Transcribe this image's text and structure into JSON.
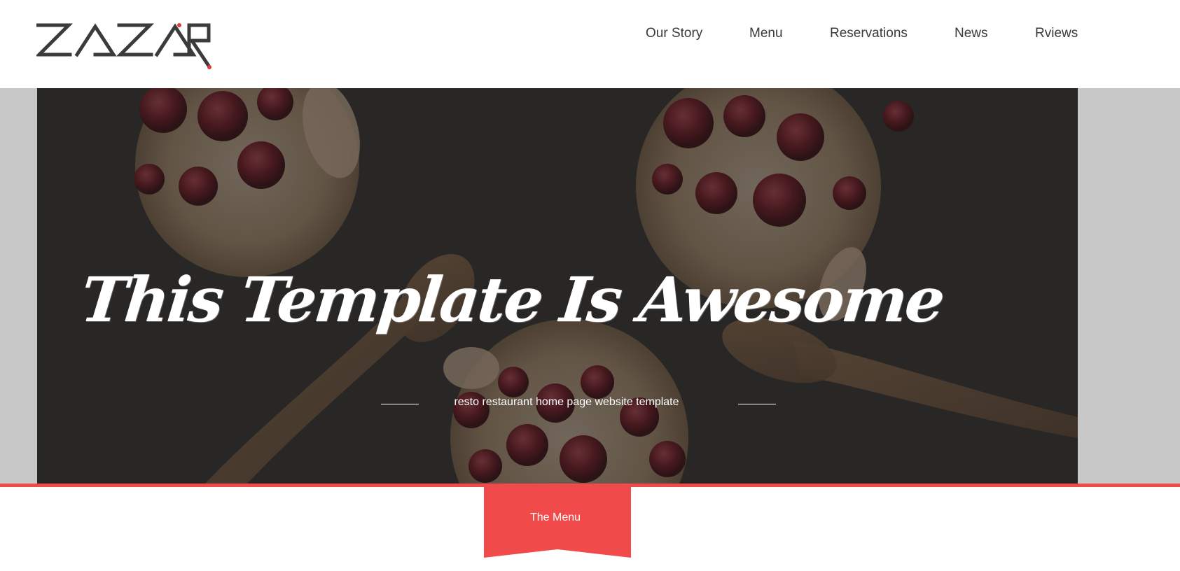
{
  "brand": {
    "logo_text": "ZA ZAR",
    "accent": "#f04a4a"
  },
  "nav": {
    "items": [
      {
        "label": "Our Story"
      },
      {
        "label": "Menu"
      },
      {
        "label": "Reservations"
      },
      {
        "label": "News"
      },
      {
        "label": "Rviews"
      }
    ]
  },
  "hero": {
    "title": "This Template Is Awesome",
    "subtitle": "resto restaurant home page website template"
  },
  "section": {
    "ribbon_label": "The Menu"
  }
}
